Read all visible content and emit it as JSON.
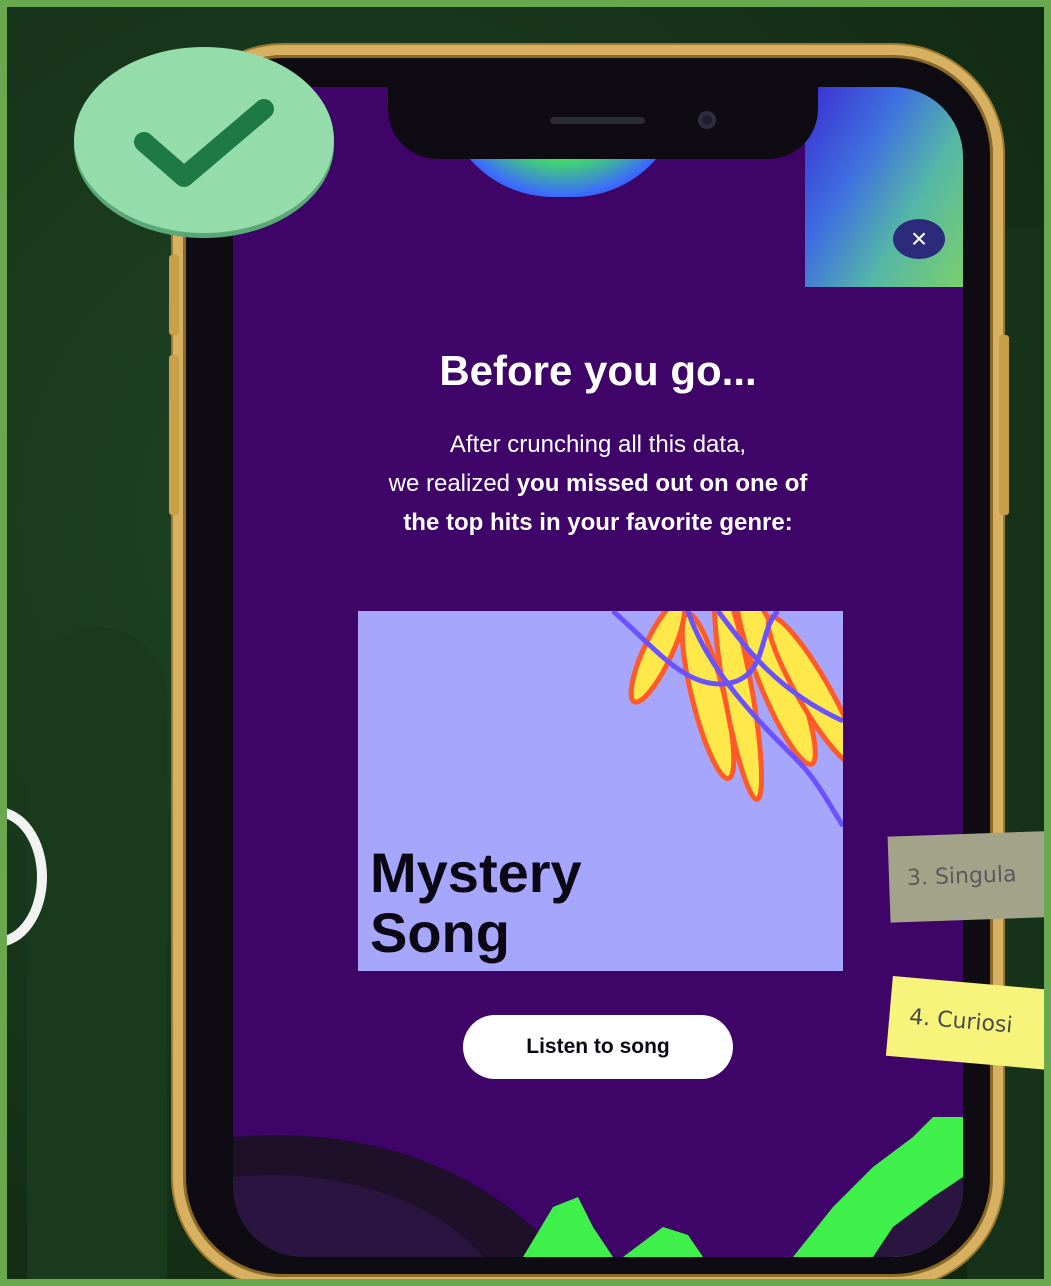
{
  "modal": {
    "title": "Before you go...",
    "desc_line1": "After crunching all this data,",
    "desc_line2_plain": "we realized ",
    "desc_line2_bold": "you missed out on one of",
    "desc_line3_bold": "the top hits in your favorite genre:",
    "close_symbol": "×",
    "cover_title_line1": "Mystery",
    "cover_title_line2": "Song",
    "listen_button": "Listen to song"
  },
  "notes": {
    "note3": "3. Singula",
    "note4": "4. Curiosi"
  },
  "icons": {
    "badge": "check-icon",
    "close": "close-icon"
  },
  "colors": {
    "screen_bg": "#3e0468",
    "cover_bg": "#a7a6fd",
    "badge_bg": "#95dcab",
    "check": "#1e7a44",
    "phone_frame": "#d7b062",
    "accent_green": "#3ff04a"
  }
}
